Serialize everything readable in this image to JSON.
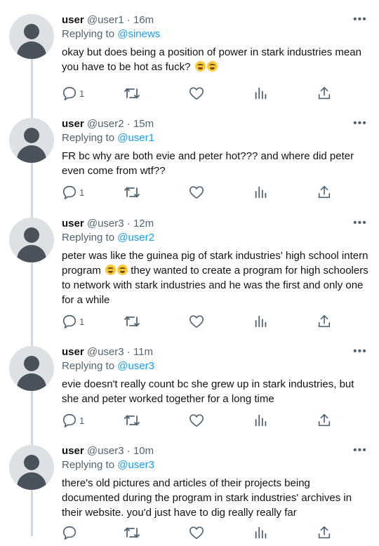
{
  "tweets": [
    {
      "name": "user",
      "handle": "@user1",
      "time": "16m",
      "replying_prefix": "Replying to ",
      "replying_to": "@sinews",
      "text": "okay but does being a position of power in stark industries mean you have to be hot as fuck?",
      "emojis": "😂😂",
      "reply_count": "1"
    },
    {
      "name": "user",
      "handle": "@user2",
      "time": "15m",
      "replying_prefix": "Replying to ",
      "replying_to": "@user1",
      "text": "FR bc why are both evie and peter hot??? and where did peter even come from wtf??",
      "reply_count": "1"
    },
    {
      "name": "user",
      "handle": "@user3",
      "time": "12m",
      "replying_prefix": "Replying to ",
      "replying_to": "@user2",
      "text_a": "peter was like the guinea pig of stark industries' high school intern program",
      "emojis": "😂😂",
      "text_b": "they wanted to create a program for high schoolers to network with stark industries and he was the first and only one for a while",
      "reply_count": "1"
    },
    {
      "name": "user",
      "handle": "@user3",
      "time": "11m",
      "replying_prefix": "Replying to ",
      "replying_to": "@user3",
      "text": "evie doesn't really count bc she grew up in stark industries, but she and peter worked together for a long time",
      "reply_count": "1"
    },
    {
      "name": "user",
      "handle": "@user3",
      "time": "10m",
      "replying_prefix": "Replying to ",
      "replying_to": "@user3",
      "text": "there's old pictures and articles of their projects being documented during the program in stark industries' archives in their website. you'd just have to dig really really far",
      "reply_count": ""
    }
  ],
  "separator": "·",
  "more_icon": "•••"
}
